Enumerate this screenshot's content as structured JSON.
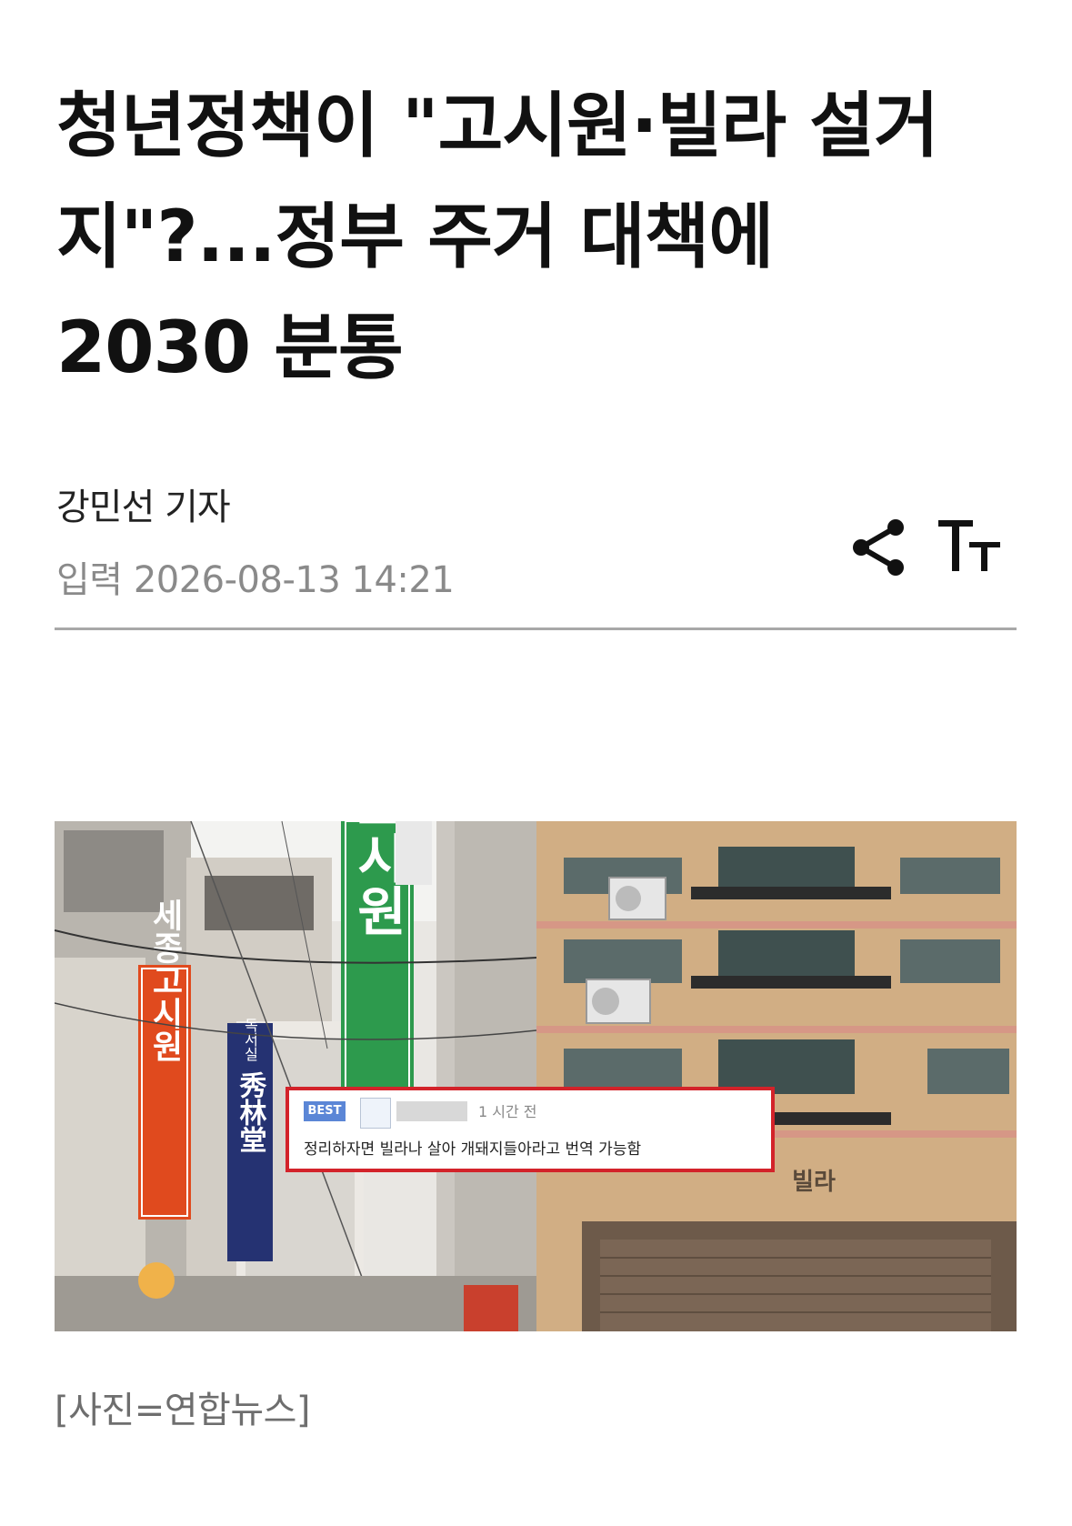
{
  "article": {
    "headline_lines": [
      "청년정책이 \"고시원·빌라 설거",
      "지\"?...정부 주거 대책에",
      "2030 분통"
    ],
    "reporter": "강민선 기자",
    "published": "입력 2026-08-13 14:21"
  },
  "toolbar": {
    "share_icon": "share-icon",
    "text_size_icon": "text-size-icon"
  },
  "photo": {
    "signs": {
      "goshiwon_vertical": "고시원",
      "sejong": "세종고시원",
      "dokseosil": "독서실",
      "hanja": "秀林堂",
      "villa": "빌라"
    },
    "comment": {
      "badge": "BEST",
      "time": "1 시간 전",
      "text": "정리하자면 빌라나 살아 개돼지들아라고 번역 가능함"
    }
  },
  "caption": "[사진=연합뉴스]"
}
